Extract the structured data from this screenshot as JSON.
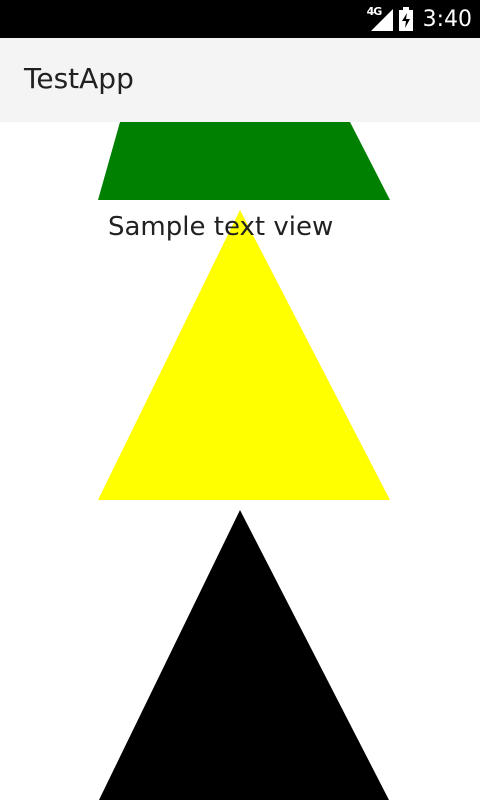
{
  "status_bar": {
    "network_type": "4G",
    "signal_icon": "cell-signal-icon",
    "battery_icon": "battery-charging-icon",
    "time": "3:40"
  },
  "app_bar": {
    "title": "TestApp"
  },
  "content": {
    "sample_text": "Sample text view",
    "shapes": [
      {
        "name": "green-trapezoid",
        "color": "#008000"
      },
      {
        "name": "yellow-triangle",
        "color": "#ffff00"
      },
      {
        "name": "black-triangle",
        "color": "#000000"
      }
    ]
  }
}
